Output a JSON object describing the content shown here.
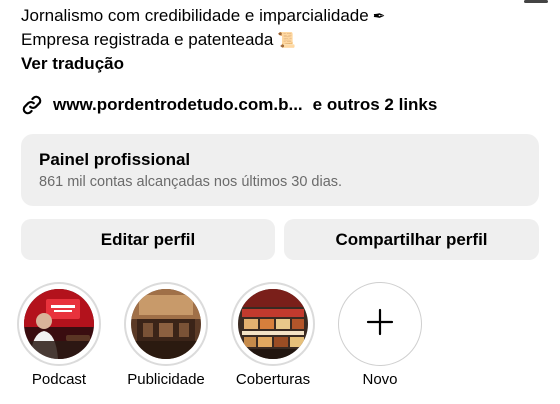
{
  "bio": {
    "line1": "Jornalismo com credibilidade e imparcialidade",
    "line1_emoji": "✒",
    "line2": "Empresa registrada e patenteada",
    "line2_emoji": "📜",
    "translate_label": "Ver tradução"
  },
  "links": {
    "icon": "link-icon",
    "primary": "www.pordentrodetudo.com.b...",
    "more": "e outros 2 links"
  },
  "dashboard": {
    "title": "Painel profissional",
    "subtitle": "861 mil contas alcançadas nos últimos 30 dias."
  },
  "buttons": {
    "edit_profile": "Editar perfil",
    "share_profile": "Compartilhar perfil"
  },
  "highlights": [
    {
      "label": "Podcast"
    },
    {
      "label": "Publicidade"
    },
    {
      "label": "Coberturas"
    },
    {
      "label": "Novo",
      "icon": "plus-icon"
    }
  ],
  "colors": {
    "button_bg": "#efefef",
    "secondary_text": "#6b6b6b",
    "ring": "#dbdbdb"
  }
}
